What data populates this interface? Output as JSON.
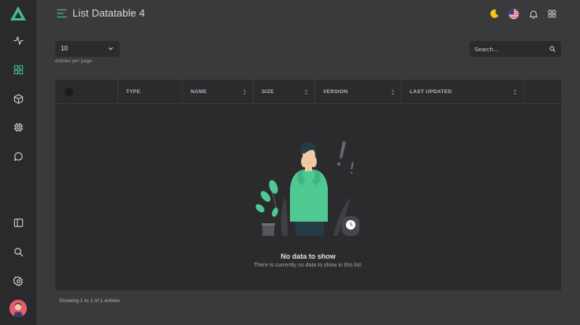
{
  "header": {
    "title": "List Datatable 4"
  },
  "sidebar": {
    "items": [
      {
        "icon": "activity-icon"
      },
      {
        "icon": "grid-icon",
        "active": true
      },
      {
        "icon": "box-icon"
      },
      {
        "icon": "cpu-icon"
      },
      {
        "icon": "message-icon"
      }
    ],
    "bottom": [
      {
        "icon": "sidebar-panel-icon"
      },
      {
        "icon": "search-icon"
      },
      {
        "icon": "gear-icon"
      }
    ]
  },
  "toolbar": {
    "icons": [
      "moon-icon",
      "us-flag-icon",
      "bell-icon",
      "apps-grid-icon"
    ]
  },
  "table_controls": {
    "entries_value": "10",
    "entries_label": "entries per page",
    "search_placeholder": "Search..."
  },
  "table": {
    "columns": [
      "TYPE",
      "NAME",
      "SIZE",
      "VERSION",
      "LAST UPDATED"
    ],
    "rows": []
  },
  "empty_state": {
    "title": "No data to show",
    "subtitle": "There is currently no data to show in this list."
  },
  "footer": {
    "info": "Showing 1 to 1 of 1 entries"
  },
  "colors": {
    "accent": "#3fbf86",
    "background": "#3a3a3d",
    "panel": "#2b2b2e",
    "sidebar": "#2a2a2d"
  }
}
